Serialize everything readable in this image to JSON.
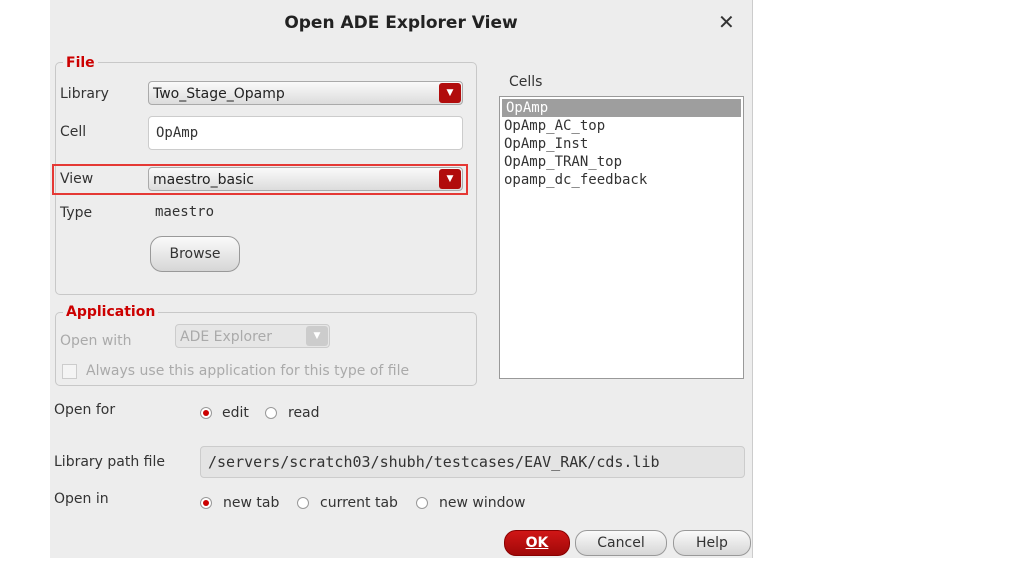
{
  "title": "Open ADE Explorer View",
  "file": {
    "legend": "File",
    "library_label": "Library",
    "library_value": "Two_Stage_Opamp",
    "cell_label": "Cell",
    "cell_value": "OpAmp",
    "view_label": "View",
    "view_value": "maestro_basic",
    "type_label": "Type",
    "type_value": "maestro",
    "browse": "Browse"
  },
  "application": {
    "legend": "Application",
    "open_with_label": "Open with",
    "open_with_value": "ADE Explorer",
    "always_use": "Always use this application for this type of file"
  },
  "cells": {
    "label": "Cells",
    "items": [
      "OpAmp",
      "OpAmp_AC_top",
      "OpAmp_Inst",
      "OpAmp_TRAN_top",
      "opamp_dc_feedback"
    ],
    "selected": "OpAmp"
  },
  "open_for": {
    "label": "Open for",
    "options": [
      "edit",
      "read"
    ],
    "selected": "edit"
  },
  "library_path": {
    "label": "Library path file",
    "value": "/servers/scratch03/shubh/testcases/EAV_RAK/cds.lib"
  },
  "open_in": {
    "label": "Open in",
    "options": [
      "new tab",
      "current tab",
      "new window"
    ],
    "selected": "new tab"
  },
  "buttons": {
    "ok": "OK",
    "cancel": "Cancel",
    "help": "Help"
  },
  "colors": {
    "accent": "#b10c0c",
    "highlight": "#e53935"
  }
}
